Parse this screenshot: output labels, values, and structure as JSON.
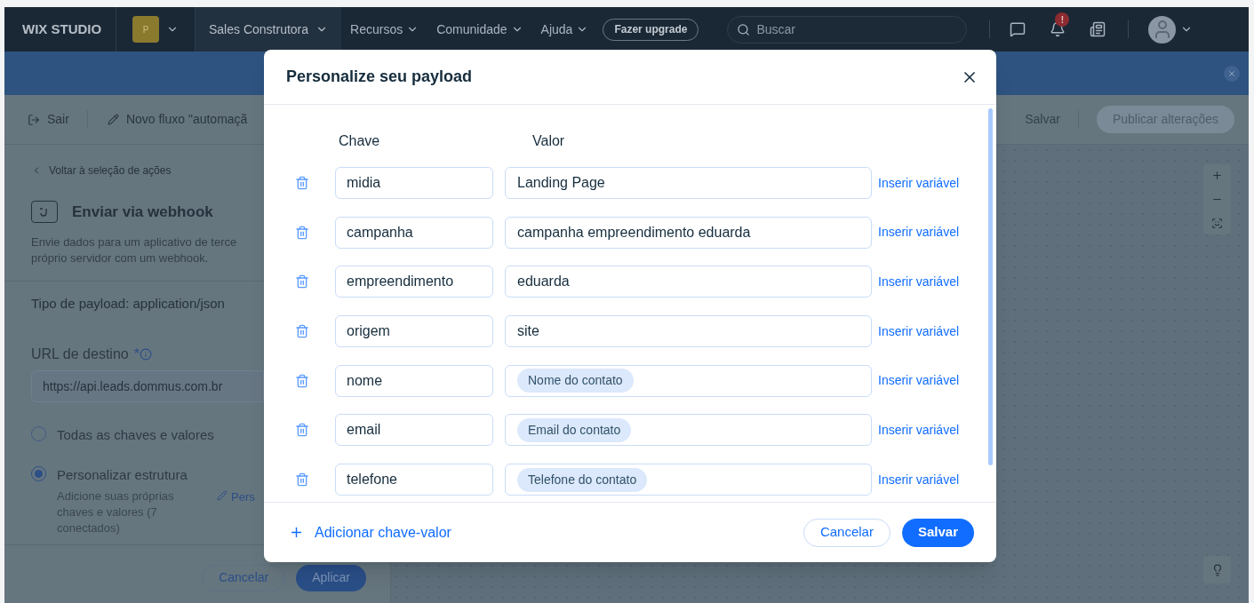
{
  "topbar": {
    "logo": "WIX STUDIO",
    "workspace_initial": "P",
    "site_menu": "Sales Construtora",
    "menus": [
      "Recursos",
      "Comunidade",
      "Ajuda"
    ],
    "upgrade": "Fazer upgrade",
    "search": {
      "placeholder": "Buscar"
    },
    "notification_badge": "!"
  },
  "toolbar": {
    "exit": "Sair",
    "flow_name": "Novo fluxo \"automaçã",
    "save": "Salvar",
    "publish": "Publicar alterações"
  },
  "panel": {
    "back": "Voltar à seleção de ações",
    "title": "Enviar via webhook",
    "description": [
      "Envie dados para um aplicativo de terce",
      "próprio servidor com um webhook."
    ],
    "payload_type": "Tipo de payload: application/json",
    "url_label": "URL de destino",
    "required_mark": "*",
    "url_value": "https://api.leads.dommus.com.br",
    "options": [
      {
        "label": "Todas as chaves e valores",
        "selected": false
      },
      {
        "label": "Personalizar estrutura",
        "selected": true,
        "hint": "Adicione suas próprias chaves e valores (7 conectados)",
        "link": "Pers"
      }
    ],
    "buttons": {
      "cancel": "Cancelar",
      "apply": "Aplicar"
    }
  },
  "dialog": {
    "title": "Personalize seu payload",
    "columns": [
      "Chave",
      "Valor"
    ],
    "rows": [
      {
        "key": "midia",
        "value": "Landing Page",
        "kind": "text",
        "action": "Inserir variável"
      },
      {
        "key": "campanha",
        "value": "campanha empreendimento eduarda",
        "kind": "text",
        "action": "Inserir variável"
      },
      {
        "key": "empreendimento",
        "value": "eduarda",
        "kind": "text",
        "action": "Inserir variável"
      },
      {
        "key": "origem",
        "value": "site",
        "kind": "text",
        "action": "Inserir variável"
      },
      {
        "key": "nome",
        "value": "Nome do contato",
        "kind": "variable",
        "action": "Inserir variável"
      },
      {
        "key": "email",
        "value": "Email do contato",
        "kind": "variable",
        "action": "Inserir variável"
      },
      {
        "key": "telefone",
        "value": "Telefone do contato",
        "kind": "variable",
        "action": "Inserir variável"
      }
    ],
    "add": "Adicionar chave-valor",
    "cancel": "Cancelar",
    "save": "Salvar"
  }
}
